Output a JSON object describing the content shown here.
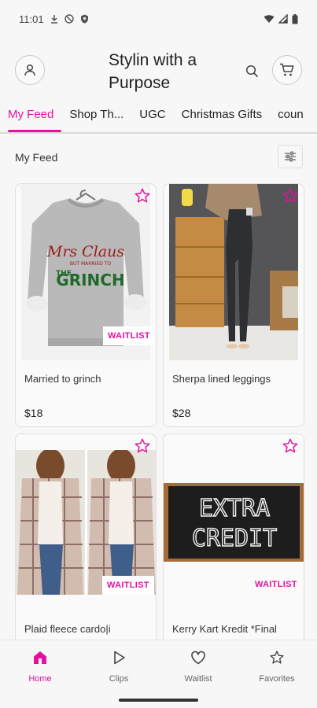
{
  "status_bar": {
    "time": "11:01"
  },
  "header": {
    "store_title": "Stylin with a Purpose",
    "avatar_icon": "user-icon",
    "search_icon": "search-icon",
    "cart_icon": "cart-icon"
  },
  "tabs": [
    {
      "label": "My Feed",
      "active": true
    },
    {
      "label": "Shop Th..."
    },
    {
      "label": "UGC"
    },
    {
      "label": "Christmas Gifts"
    },
    {
      "label": "coun"
    }
  ],
  "feed": {
    "title": "My Feed",
    "filter_icon": "sliders-icon"
  },
  "products": [
    {
      "name": "Married to grinch",
      "price": "$18",
      "badge": "WAITLIST",
      "sweater_text_1": "Mrs Claus",
      "sweater_text_2": "BUT MARRIED TO",
      "sweater_text_3": "THE",
      "sweater_text_4": "GRINCH"
    },
    {
      "name": "Sherpa lined leggings",
      "price": "$28"
    },
    {
      "name": "Plaid fleece cardo|i",
      "price": "",
      "badge": "WAITLIST"
    },
    {
      "name": "Kerry Kart Kredit *Final",
      "price": "",
      "badge": "WAITLIST",
      "chalk_line_1": "EXTRA",
      "chalk_line_2": "CREDIT"
    }
  ],
  "colors": {
    "accent": "#e4119f"
  },
  "bottom_nav": [
    {
      "label": "Home",
      "icon": "home-icon",
      "active": true
    },
    {
      "label": "Clips",
      "icon": "play-icon"
    },
    {
      "label": "Waitlist",
      "icon": "heart-icon"
    },
    {
      "label": "Favorites",
      "icon": "star-icon"
    }
  ]
}
